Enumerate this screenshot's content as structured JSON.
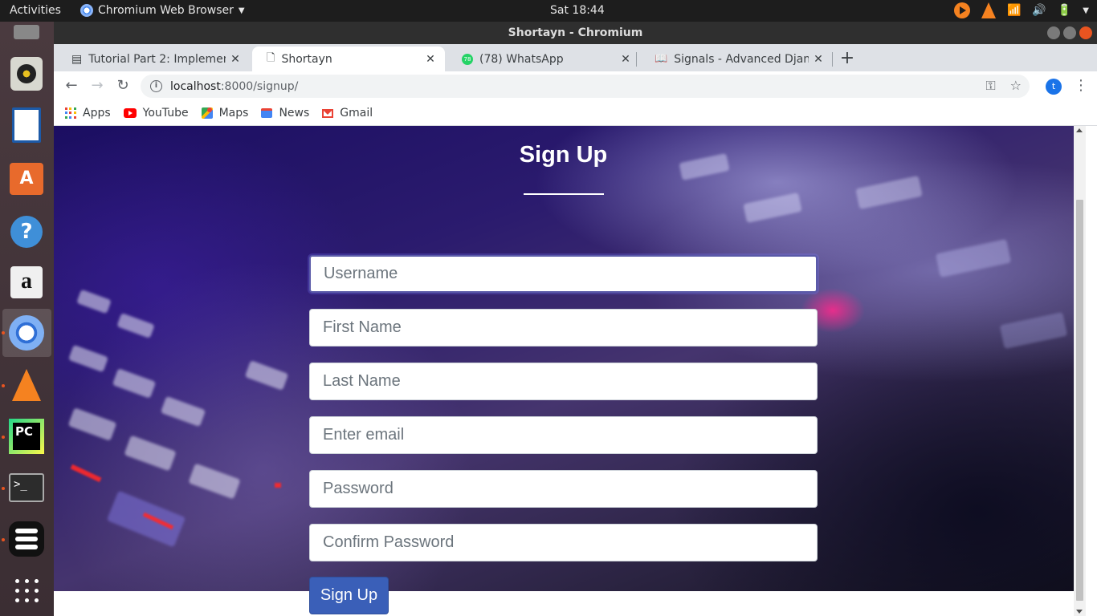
{
  "topbar": {
    "activities": "Activities",
    "app_menu": "Chromium Web Browser",
    "clock": "Sat 18:44"
  },
  "window": {
    "title": "Shortayn - Chromium"
  },
  "tabs": [
    {
      "title": "Tutorial Part 2: Implement",
      "icon": "document-icon"
    },
    {
      "title": "Shortayn",
      "icon": "page-icon",
      "active": true
    },
    {
      "title": "(78) WhatsApp",
      "icon": "whatsapp-icon",
      "badge": "78"
    },
    {
      "title": "Signals - Advanced Django",
      "icon": "book-icon"
    }
  ],
  "address_bar": {
    "host": "localhost",
    "path": ":8000/signup/"
  },
  "profile_initial": "t",
  "bookmarks": [
    {
      "label": "Apps",
      "icon": "apps-grid-icon"
    },
    {
      "label": "YouTube",
      "icon": "youtube-icon"
    },
    {
      "label": "Maps",
      "icon": "maps-icon"
    },
    {
      "label": "News",
      "icon": "news-icon"
    },
    {
      "label": "Gmail",
      "icon": "gmail-icon"
    }
  ],
  "page": {
    "title": "Sign Up",
    "fields": {
      "username": "Username",
      "first_name": "First Name",
      "last_name": "Last Name",
      "email": "Enter email",
      "password": "Password",
      "confirm_password": "Confirm Password"
    },
    "submit_label": "Sign Up"
  },
  "colors": {
    "accent_button": "#3a5fb8",
    "ubuntu_orange": "#e95420"
  }
}
